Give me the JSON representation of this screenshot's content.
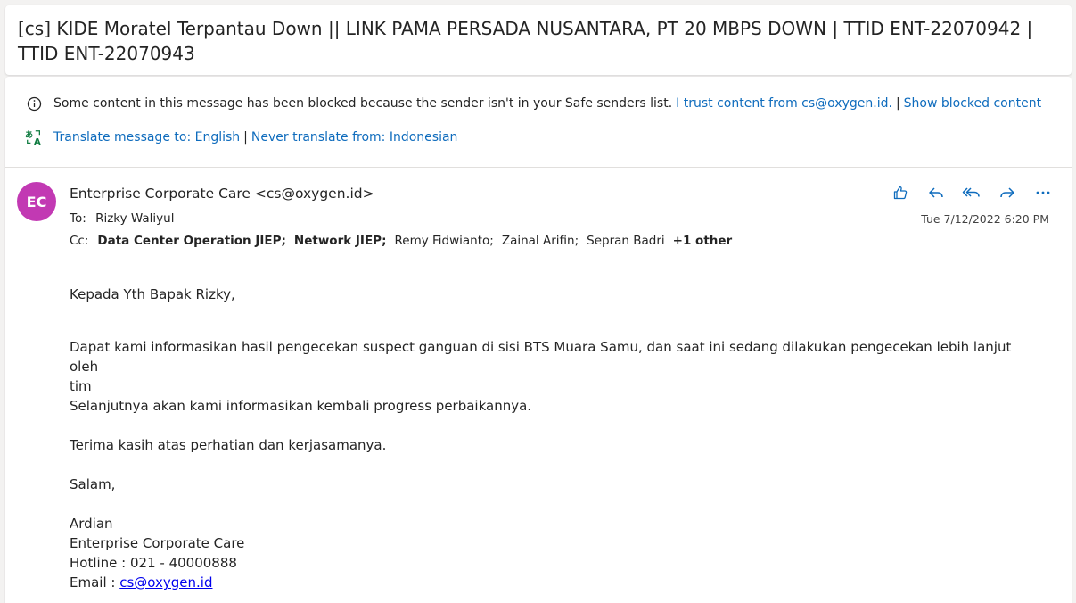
{
  "subject": "[cs] KIDE Moratel Terpantau Down || LINK PAMA PERSADA NUSANTARA, PT 20 MBPS DOWN | TTID ENT-22070942 | TTID ENT-22070943",
  "infobar": {
    "blocked_text": "Some content in this message has been blocked because the sender isn't in your Safe senders list.",
    "trust_link": "I trust content from cs@oxygen.id.",
    "show_blocked_link": "Show blocked content",
    "translate_link": "Translate message to: English",
    "never_translate_link": "Never translate from: Indonesian",
    "separator": "|"
  },
  "sender": {
    "initials": "EC",
    "avatar_color": "#c239b3",
    "display": "Enterprise Corporate Care <cs@oxygen.id>"
  },
  "to": {
    "label": "To:",
    "value": "Rizky Waliyul"
  },
  "cc": {
    "label": "Cc:",
    "recipients": [
      "Data Center Operation JIEP;",
      "Network JIEP;",
      "Remy Fidwianto;",
      "Zainal Arifin;",
      "Sepran Badri"
    ],
    "more": "+1 other"
  },
  "date": "Tue 7/12/2022 6:20 PM",
  "actions": [
    "like-icon",
    "reply-icon",
    "reply-all-icon",
    "forward-icon",
    "more-icon"
  ],
  "body": {
    "greeting": "Kepada Yth Bapak Rizky,",
    "line1a": "Dapat kami informasikan hasil pengecekan suspect ganguan di sisi BTS Muara Samu, dan saat ini sedang dilakukan pengecekan lebih lanjut oleh",
    "line1b": "tim",
    "line2": "Selanjutnya akan kami informasikan kembali progress perbaikannya.",
    "thanks": "Terima kasih atas perhatian dan kerjasamanya.",
    "closing": "Salam,",
    "sig_name": "Ardian",
    "sig_org": "Enterprise Corporate Care",
    "sig_hotline": "Hotline : 021 - 40000888",
    "sig_email_label": "Email : ",
    "sig_email": "cs@oxygen.id"
  },
  "colors": {
    "accent": "#0f6cbd",
    "background": "#f3f2f1"
  }
}
